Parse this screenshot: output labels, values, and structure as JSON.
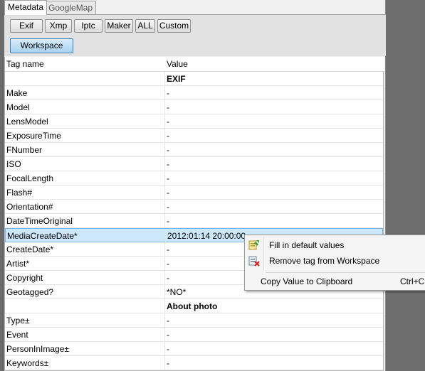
{
  "tabs": [
    {
      "label": "Metadata"
    },
    {
      "label": "GoogleMap"
    }
  ],
  "buttons": {
    "exif": "Exif",
    "xmp": "Xmp",
    "iptc": "Iptc",
    "maker": "Maker",
    "all": "ALL",
    "custom": "Custom",
    "workspace": "Workspace"
  },
  "grid": {
    "col_tag": "Tag name",
    "col_value": "Value",
    "rows": [
      {
        "tag": "",
        "value": "EXIF"
      },
      {
        "tag": "Make",
        "value": "-"
      },
      {
        "tag": "Model",
        "value": "-"
      },
      {
        "tag": "LensModel",
        "value": "-"
      },
      {
        "tag": "ExposureTime",
        "value": "-"
      },
      {
        "tag": "FNumber",
        "value": "-"
      },
      {
        "tag": "ISO",
        "value": "-"
      },
      {
        "tag": "FocalLength",
        "value": "-"
      },
      {
        "tag": "Flash#",
        "value": "-"
      },
      {
        "tag": "Orientation#",
        "value": "-"
      },
      {
        "tag": "DateTimeOriginal",
        "value": "-"
      },
      {
        "tag": "MediaCreateDate*",
        "value": "2012:01:14 20:00:00"
      },
      {
        "tag": "CreateDate*",
        "value": "-"
      },
      {
        "tag": "Artist*",
        "value": "-"
      },
      {
        "tag": "Copyright",
        "value": "-"
      },
      {
        "tag": "Geotagged?",
        "value": "*NO*"
      },
      {
        "tag": "",
        "value": "About photo"
      },
      {
        "tag": "Type±",
        "value": "-"
      },
      {
        "tag": "Event",
        "value": "-"
      },
      {
        "tag": "PersonInImage±",
        "value": "-"
      },
      {
        "tag": "Keywords±",
        "value": "-"
      }
    ]
  },
  "context_menu": {
    "fill_default": "Fill in default values",
    "remove_tag": "Remove tag from Workspace",
    "copy_value": "Copy Value to Clipboard",
    "copy_shortcut": "Ctrl+C"
  }
}
